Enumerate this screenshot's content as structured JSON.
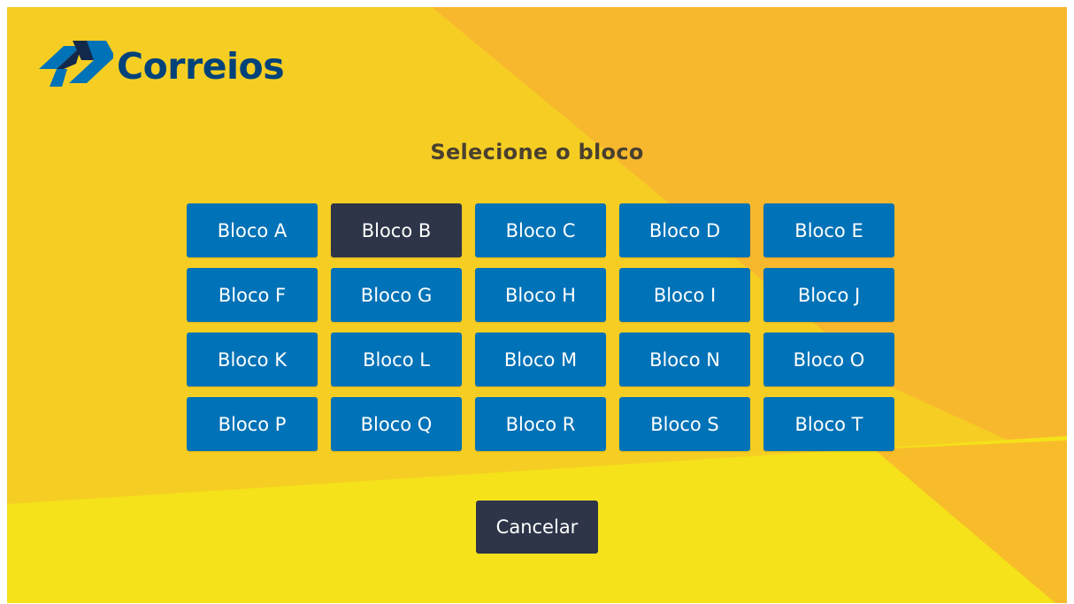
{
  "brand": {
    "name": "Correios",
    "colors": {
      "logo_blue": "#00427a",
      "logo_dark": "#13294b",
      "button_blue": "#0072b7",
      "button_dark": "#2e3548",
      "background_yellow": "#f6ce23",
      "background_orange": "#f8b82e",
      "background_lemon": "#f5e21a"
    }
  },
  "screen": {
    "title": "Selecione o bloco"
  },
  "blocks": [
    {
      "label": "Bloco A",
      "selected": false
    },
    {
      "label": "Bloco B",
      "selected": true
    },
    {
      "label": "Bloco C",
      "selected": false
    },
    {
      "label": "Bloco D",
      "selected": false
    },
    {
      "label": "Bloco E",
      "selected": false
    },
    {
      "label": "Bloco F",
      "selected": false
    },
    {
      "label": "Bloco G",
      "selected": false
    },
    {
      "label": "Bloco H",
      "selected": false
    },
    {
      "label": "Bloco I",
      "selected": false
    },
    {
      "label": "Bloco J",
      "selected": false
    },
    {
      "label": "Bloco K",
      "selected": false
    },
    {
      "label": "Bloco L",
      "selected": false
    },
    {
      "label": "Bloco M",
      "selected": false
    },
    {
      "label": "Bloco N",
      "selected": false
    },
    {
      "label": "Bloco O",
      "selected": false
    },
    {
      "label": "Bloco P",
      "selected": false
    },
    {
      "label": "Bloco Q",
      "selected": false
    },
    {
      "label": "Bloco R",
      "selected": false
    },
    {
      "label": "Bloco S",
      "selected": false
    },
    {
      "label": "Bloco T",
      "selected": false
    }
  ],
  "actions": {
    "cancel_label": "Cancelar"
  }
}
